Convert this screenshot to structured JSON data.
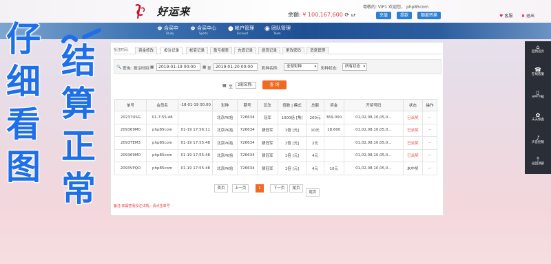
{
  "header": {
    "logo_text": "好运来",
    "user_line": "尊敬的: VIP1 欢迎您， php85com",
    "balance_label": "余额:",
    "balance_value": "¥ 100,167,600",
    "balance_refresh": "⟳",
    "balance_suffix": "GF",
    "buttons": [
      "充值",
      "提款",
      "额度转换"
    ],
    "links": [
      {
        "icon": "heart-icon",
        "label": "客服"
      },
      {
        "icon": "close-icon",
        "label": "退出"
      }
    ]
  },
  "nav": [
    {
      "icon": "trophy-icon",
      "title": "合买中",
      "sub": "Study"
    },
    {
      "icon": "trophy-icon",
      "title": "合买中心",
      "sub": "Sports"
    },
    {
      "icon": "user-icon",
      "title": "帐户管理",
      "sub": "Account"
    },
    {
      "icon": "team-icon",
      "title": "团队管理",
      "sub": "Team"
    }
  ],
  "tabs": {
    "lead": "投注时间:",
    "items": [
      "资金修改",
      "投注记录",
      "帐变记录",
      "盈亏报表",
      "充值记录",
      "提现记录",
      "更改密码",
      "消息管理"
    ],
    "active_index": 1
  },
  "filter": {
    "query_label": "查询:",
    "time_label": "投注时间:",
    "date_from": "2019-01-19 00:00",
    "to_label": "至",
    "date_to": "2019-01-20 00:00",
    "game_label": "彩种名称:",
    "game_value": "全部彩种",
    "status_label": "彩种状态:",
    "status_value": "所有状态",
    "query_button": "查 询"
  },
  "floating": {
    "to_label": "至",
    "field_text": "2彩名称:",
    "cell_text": "-18-01-19 00:00"
  },
  "table": {
    "headers": [
      "单号",
      "会员名",
      "时间",
      "彩种",
      "期号",
      "玩法",
      "倍数 | 模式",
      "总额",
      "奖金",
      "开奖号码",
      "状态",
      "操作"
    ],
    "rows": [
      [
        "20237USG",
        "01-7:55:48",
        "",
        "北京PK拾",
        "726634",
        "冠军",
        "1000倍 [角]",
        "200元",
        "369.000",
        "01,02,08,10,05,0...",
        "已派奖",
        "···"
      ],
      [
        "209369M0",
        "php85com",
        "01-19 17:56:11",
        "北京PK拾",
        "726634",
        "猜冠军",
        "1倍 [元]",
        "10元",
        "18.600",
        "01,02,08,10,05,0...",
        "已派奖",
        "···"
      ],
      [
        "2093TEM3",
        "php85com",
        "01-19 17:55:48",
        "北京PK拾",
        "726634",
        "猜冠军",
        "1倍 [元]",
        "2元",
        "",
        "01,02,08,10,05,0...",
        "已派奖",
        "···"
      ],
      [
        "209369M0",
        "php85com",
        "01-19 17:55:48",
        "北京PK拾",
        "726634",
        "猜冠军",
        "1倍 [元]",
        "4元",
        "",
        "01,02,08,10,05,0...",
        "已派奖",
        "···"
      ],
      [
        "2093VPQO",
        "php85com",
        "01-19 17:55:48",
        "北京PK拾",
        "726634",
        "猜冠军",
        "1倍 [元]",
        "4元",
        "10元",
        "01,02,08,10,05,0...",
        "未中奖",
        "···"
      ]
    ],
    "extra_cells": {
      "prize_row3": "--",
      "draw_row3": "10,05,0...",
      "prize_row4": "2元",
      "draw_row5": "",
      "total_extra": "2元"
    },
    "status_colors": {
      "已派奖": "#e23b3b",
      "未中奖": "#444444"
    }
  },
  "pager": {
    "items": [
      "首页",
      "上一页",
      "1",
      "下一页",
      "尾页",
      "尾页"
    ],
    "active_index": 2
  },
  "note": "备注:如需查看投注详情，请点击单号",
  "sidebar": [
    {
      "icon": "home-icon",
      "label": "回到首页"
    },
    {
      "icon": "headset-icon",
      "label": "在线客服"
    },
    {
      "icon": "phone-icon",
      "label": "APP下载"
    },
    {
      "icon": "gift-icon",
      "label": "天天惊喜"
    },
    {
      "icon": "volume-icon",
      "label": "声音控制"
    },
    {
      "icon": "top-icon",
      "label": "返回顶部"
    }
  ],
  "overlay": {
    "left_column": [
      "仔",
      "细",
      "看",
      "图"
    ],
    "right_column": [
      "结",
      "算",
      "正",
      "常"
    ],
    "color": "#1f6fe8"
  }
}
